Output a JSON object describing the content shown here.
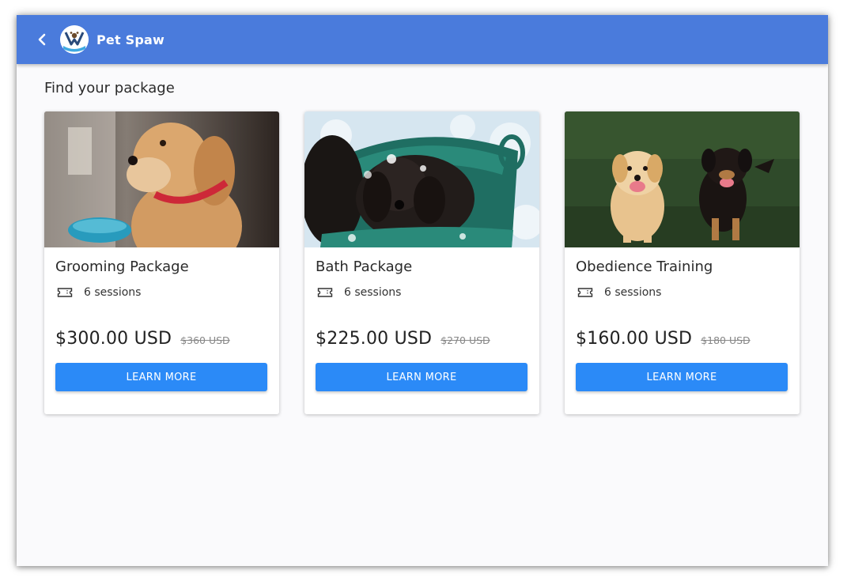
{
  "header": {
    "brand": "Pet Spaw",
    "back_icon": "chevron-left-icon",
    "logo_icon": "pet-spaw-logo",
    "bar_color": "#4a7bdc"
  },
  "page": {
    "title": "Find your package"
  },
  "packages": [
    {
      "title": "Grooming Package",
      "sessions": "6 sessions",
      "price": "$300.00 USD",
      "old_price": "$360 USD",
      "button": "LEARN MORE",
      "image": "puppy-photo"
    },
    {
      "title": "Bath Package",
      "sessions": "6 sessions",
      "price": "$225.00 USD",
      "old_price": "$270 USD",
      "button": "LEARN MORE",
      "image": "dog-bath-photo"
    },
    {
      "title": "Obedience Training",
      "sessions": "6 sessions",
      "price": "$160.00 USD",
      "old_price": "$180 USD",
      "button": "LEARN MORE",
      "image": "two-dogs-photo"
    }
  ],
  "colors": {
    "button": "#2b8af7",
    "background": "#fafafc"
  }
}
